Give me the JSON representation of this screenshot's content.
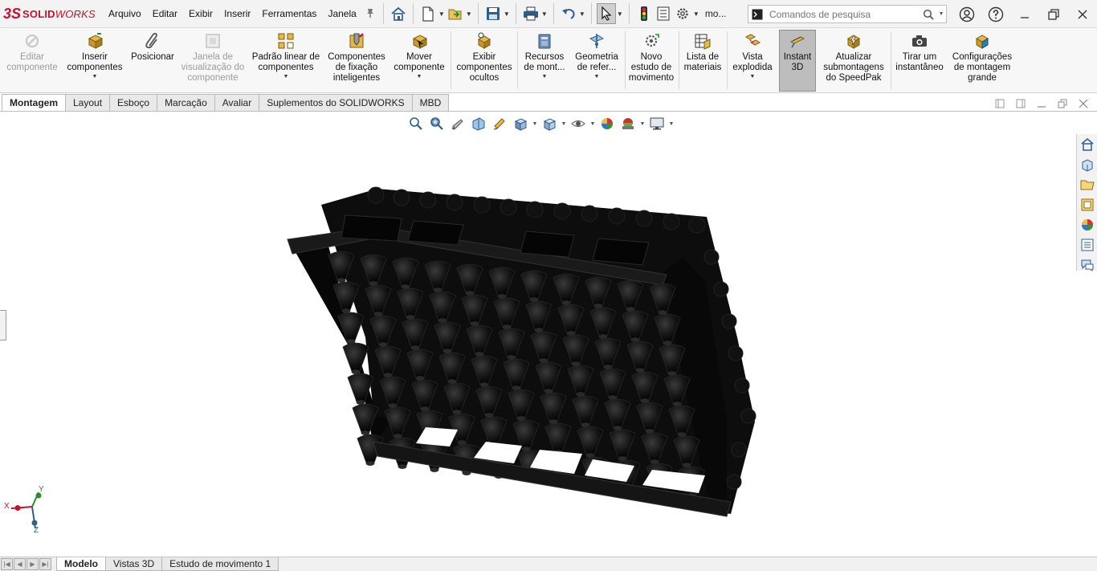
{
  "app": {
    "brand_ds": "3S",
    "brand_name": "SOLID",
    "brand_name2": "WORKS"
  },
  "menu": {
    "items": [
      "Arquivo",
      "Editar",
      "Exibir",
      "Inserir",
      "Ferramentas",
      "Janela"
    ]
  },
  "quick_access": {
    "doc_title": "mo..."
  },
  "search": {
    "placeholder": "Comandos de pesquisa"
  },
  "ribbon": {
    "buttons": [
      {
        "label": "Editar componente",
        "icon": "edit-component-icon",
        "disabled": true
      },
      {
        "label": "Inserir componentes",
        "icon": "insert-components-icon",
        "disabled": false
      },
      {
        "label": "Posicionar",
        "icon": "mate-paperclip-icon",
        "disabled": false
      },
      {
        "label": "Janela de visualização do componente",
        "icon": "component-preview-icon",
        "disabled": true
      },
      {
        "label": "Padrão linear de componentes",
        "icon": "linear-pattern-icon",
        "disabled": false
      },
      {
        "label": "Componentes de fixação inteligentes",
        "icon": "smart-fasteners-icon",
        "disabled": false
      },
      {
        "label": "Mover componente",
        "icon": "move-component-icon",
        "disabled": false
      },
      {
        "label": "Exibir componentes ocultos",
        "icon": "show-hidden-icon",
        "disabled": false
      },
      {
        "label": "Recursos de mont...",
        "icon": "assembly-features-icon",
        "disabled": false
      },
      {
        "label": "Geometria de refer...",
        "icon": "reference-geometry-icon",
        "disabled": false
      },
      {
        "label": "Novo estudo de movimento",
        "icon": "motion-study-icon",
        "disabled": false
      },
      {
        "label": "Lista de materiais",
        "icon": "bill-of-materials-icon",
        "disabled": false
      },
      {
        "label": "Vista explodida",
        "icon": "exploded-view-icon",
        "disabled": false
      },
      {
        "label": "Instant 3D",
        "icon": "instant3d-icon",
        "disabled": false,
        "active": true
      },
      {
        "label": "Atualizar submontagens do SpeedPak",
        "icon": "speedpak-icon",
        "disabled": false
      },
      {
        "label": "Tirar um instantâneo",
        "icon": "camera-icon",
        "disabled": false
      },
      {
        "label": "Configurações de montagem grande",
        "icon": "large-assembly-icon",
        "disabled": false
      }
    ]
  },
  "tabs": {
    "items": [
      "Montagem",
      "Layout",
      "Esboço",
      "Marcação",
      "Avaliar",
      "Suplementos do SOLIDWORKS",
      "MBD"
    ],
    "active": "Montagem"
  },
  "triad": {
    "x": "X",
    "y": "Y",
    "z": "Z"
  },
  "bottom_tabs": {
    "items": [
      "Modelo",
      "Vistas 3D",
      "Estudo de movimento 1"
    ],
    "active": "Modelo"
  },
  "colors": {
    "brand": "#c8102e",
    "model": "#0a0a0a",
    "active_button": "#bdbdbd"
  }
}
